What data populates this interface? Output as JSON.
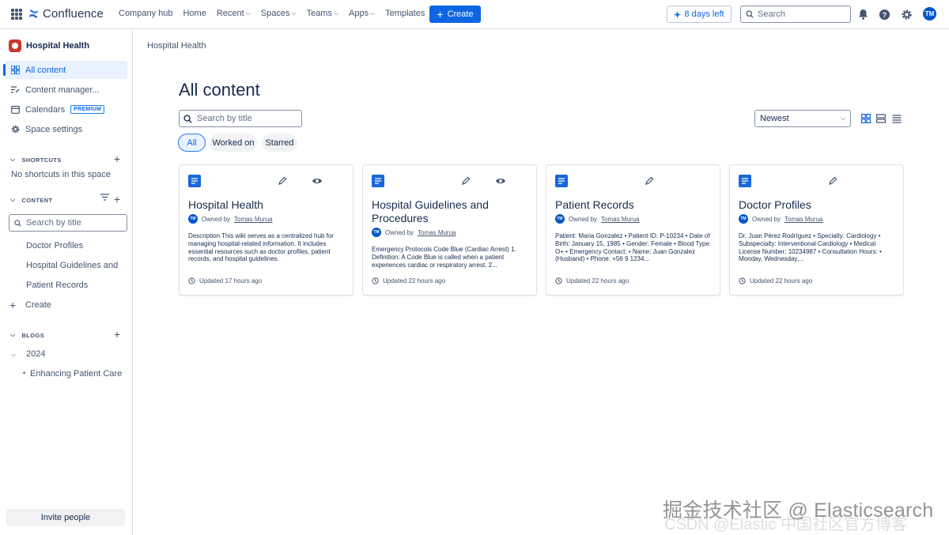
{
  "topnav": {
    "logo": "Confluence",
    "items": [
      {
        "label": "Company hub",
        "dropdown": false
      },
      {
        "label": "Home",
        "dropdown": false
      },
      {
        "label": "Recent",
        "dropdown": true
      },
      {
        "label": "Spaces",
        "dropdown": true
      },
      {
        "label": "Teams",
        "dropdown": true
      },
      {
        "label": "Apps",
        "dropdown": true
      },
      {
        "label": "Templates",
        "dropdown": false
      }
    ],
    "create_label": "Create",
    "trial_label": "8 days left",
    "search_placeholder": "Search",
    "avatar_initials": "TM"
  },
  "sidebar": {
    "space_name": "Hospital Health",
    "items": [
      {
        "label": "All content",
        "icon": "grid-icon",
        "active": true
      },
      {
        "label": "Content manager...",
        "icon": "content-manager-icon"
      },
      {
        "label": "Calendars",
        "icon": "calendar-icon",
        "badge": "PREMIUM"
      },
      {
        "label": "Space settings",
        "icon": "gear-icon"
      }
    ],
    "shortcuts_heading": "SHORTCUTS",
    "shortcuts_empty": "No shortcuts in this space",
    "content_heading": "CONTENT",
    "search_placeholder": "Search by title",
    "tree": [
      "Doctor Profiles",
      "Hospital Guidelines and Procedures",
      "Patient Records"
    ],
    "create_label": "Create",
    "blogs_heading": "BLOGS",
    "blog_year": "2024",
    "blog_post": "Enhancing Patient Care Through Technology",
    "invite_label": "Invite people"
  },
  "main": {
    "breadcrumb": "Hospital Health",
    "title": "All content",
    "search_placeholder": "Search by title",
    "sort_value": "Newest",
    "filters": [
      {
        "label": "All",
        "active": true
      },
      {
        "label": "Worked on",
        "active": false
      },
      {
        "label": "Starred",
        "active": false
      }
    ],
    "cards": [
      {
        "title": "Hospital Health",
        "owner_prefix": "Owned by",
        "owner": "Tomas Murua",
        "desc": "Description This wiki serves as a centralized hub for managing hospital-related information. It includes essential resources such as doctor profiles, patient records, and hospital guidelines.",
        "updated": "Updated 17 hours ago",
        "watching": true
      },
      {
        "title": "Hospital Guidelines and Procedures",
        "owner_prefix": "Owned by",
        "owner": "Tomas Murua",
        "desc": "Emergency Protocols Code Blue (Cardiac Arrest) 1. Definition: A Code Blue is called when a patient experiences cardiac or respiratory arrest. 2...",
        "updated": "Updated 22 hours ago",
        "watching": true
      },
      {
        "title": "Patient Records",
        "owner_prefix": "Owned by",
        "owner": "Tomas Murua",
        "desc": "Patient: Maria Gonzalez • Patient ID: P-10234 • Date of Birth: January 15, 1985 • Gender: Female • Blood Type: O+ • Emergency Contact: • Name: Juan Gonzalez (Husband) • Phone: +56 9 1234...",
        "updated": "Updated 22 hours ago",
        "watching": false
      },
      {
        "title": "Doctor Profiles",
        "owner_prefix": "Owned by",
        "owner": "Tomas Murua",
        "desc": "Dr. Juan Pérez Rodríguez • Specialty: Cardiology • Subspecialty: Interventional Cardiology • Medical License Number: 10234987 • Consultation Hours: • Monday, Wednesday,...",
        "updated": "Updated 22 hours ago",
        "watching": false
      }
    ]
  },
  "watermark": {
    "line1": "掘金技术社区 @ Elasticsearch",
    "line2": "CSDN @Elastic 中国社区官方博客"
  },
  "colors": {
    "primary": "#0c66e4",
    "text": "#172b4d",
    "subtle": "#44546f",
    "space_avatar": "#c9372c",
    "page_icon": "#1868db"
  }
}
